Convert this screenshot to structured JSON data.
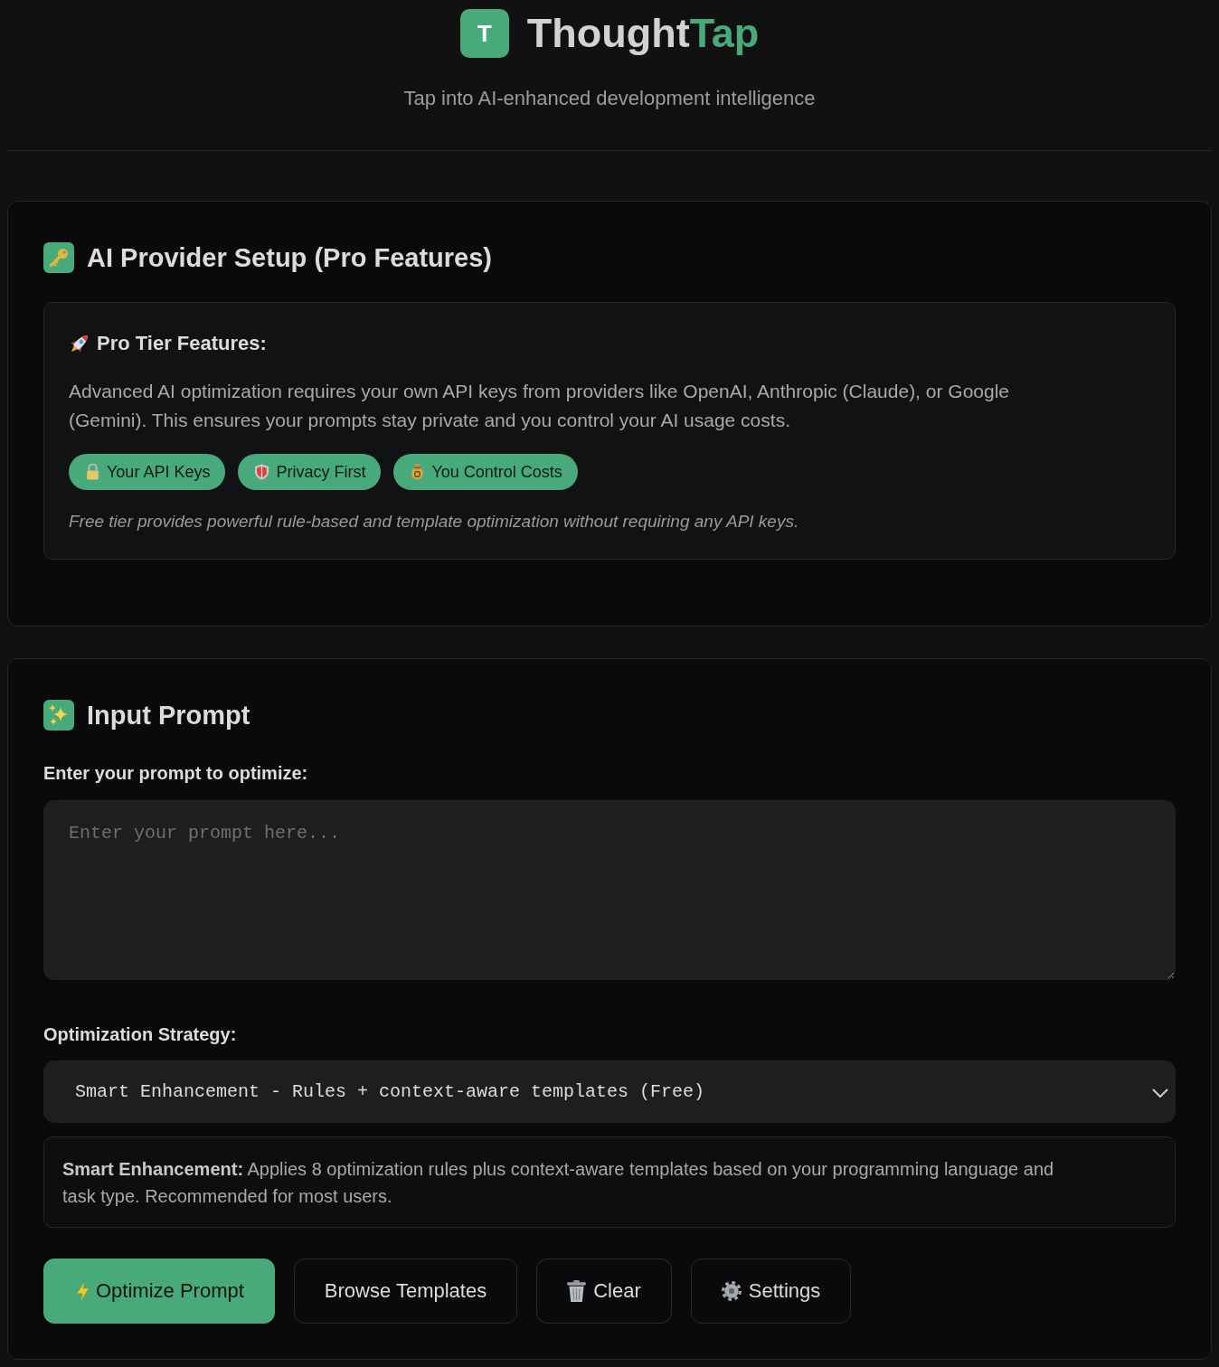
{
  "header": {
    "logo_letter": "T",
    "title": {
      "main": "Thought",
      "accent": "Tap"
    },
    "subtitle": "Tap into AI-enhanced development intelligence"
  },
  "provider_section": {
    "title": "AI Provider Setup (Pro Features)",
    "info": {
      "heading": "Pro Tier Features:",
      "description": "Advanced AI optimization requires your own API keys from providers like OpenAI, Anthropic (Claude), or Google (Gemini). This ensures your prompts stay private and you control your AI usage costs.",
      "badges": [
        "Your API Keys",
        "Privacy First",
        "You Control Costs"
      ],
      "note": "Free tier provides powerful rule-based and template optimization without requiring any API keys."
    }
  },
  "input_section": {
    "title": "Input Prompt",
    "prompt_label": "Enter your prompt to optimize:",
    "prompt_input": {
      "placeholder": "Enter your prompt here..."
    },
    "strategy_label": "Optimization Strategy:",
    "strategy_select": {
      "value": "Smart Enhancement - Rules + context-aware templates (Free)"
    },
    "strategy_description": "**Smart Enhancement:** Applies 8 optimization rules plus context-aware templates based on your programming language and task type. Recommended for most users.",
    "buttons": [
      {
        "label": "Optimize Prompt",
        "kind": "primary"
      },
      {
        "label": "Browse Templates",
        "kind": "secondary"
      },
      {
        "label": "Clear",
        "kind": "secondary"
      },
      {
        "label": "Settings",
        "kind": "secondary"
      }
    ]
  }
}
